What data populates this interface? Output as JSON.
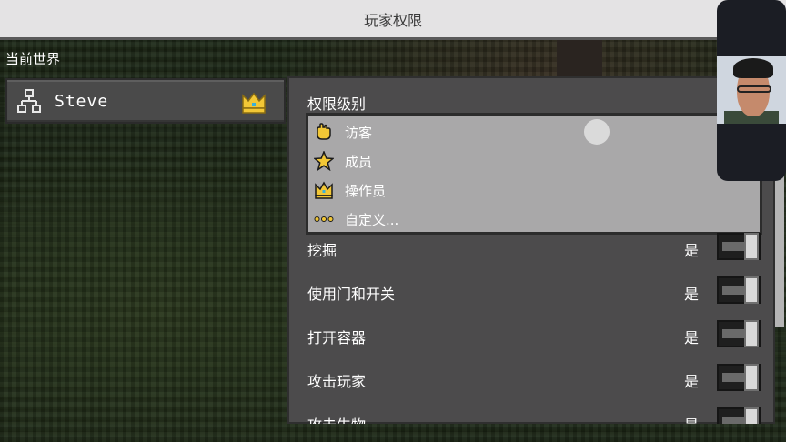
{
  "title": "玩家权限",
  "world_label": "当前世界",
  "player": {
    "name": "Steve",
    "icon": "network-icon",
    "badge": "crown-icon"
  },
  "permission_level": {
    "label": "权限级别",
    "options": [
      {
        "label": "访客",
        "icon": "hand-icon"
      },
      {
        "label": "成员",
        "icon": "star-icon"
      },
      {
        "label": "操作员",
        "icon": "crown-icon"
      },
      {
        "label": "自定义...",
        "icon": "dots-icon"
      }
    ]
  },
  "permissions": [
    {
      "label": "挖掘",
      "state": "是"
    },
    {
      "label": "使用门和开关",
      "state": "是"
    },
    {
      "label": "打开容器",
      "state": "是"
    },
    {
      "label": "攻击玩家",
      "state": "是"
    },
    {
      "label": "攻击生物",
      "state": "是"
    }
  ],
  "colors": {
    "titlebar": "#e4e3e4",
    "panel": "#4c4b4c",
    "dropdown": "#a9a8a9",
    "gold": "#f2c736"
  }
}
